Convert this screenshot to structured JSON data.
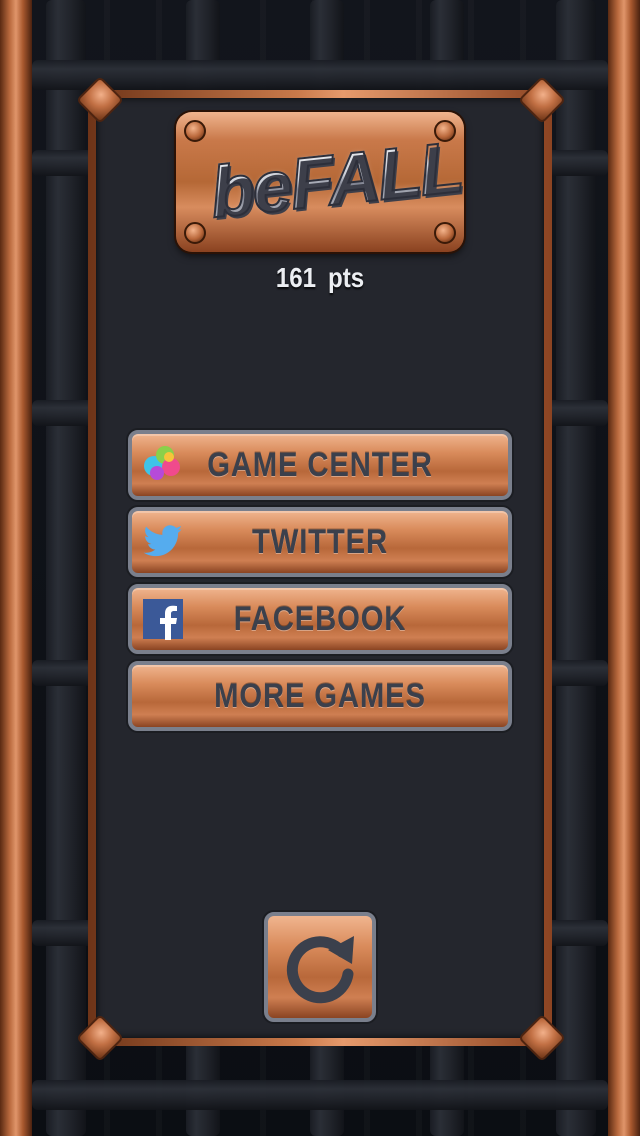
{
  "game": {
    "logo_text": "beFALL",
    "score_value": "161",
    "score_unit": "pts"
  },
  "menu": {
    "items": [
      {
        "label": "GAME CENTER",
        "icon": "game-center-icon"
      },
      {
        "label": "TWITTER",
        "icon": "twitter-bird-icon"
      },
      {
        "label": "FACEBOOK",
        "icon": "facebook-f-icon"
      },
      {
        "label": "MORE GAMES",
        "icon": ""
      }
    ],
    "replay_icon": "restart-arrow-icon"
  },
  "colors": {
    "copper": "#c9794a",
    "panel_bg": "#24262d",
    "button_text": "#3b404c",
    "button_border": "#7a7f8c",
    "twitter_blue": "#55acee",
    "facebook_blue": "#3b5998"
  }
}
